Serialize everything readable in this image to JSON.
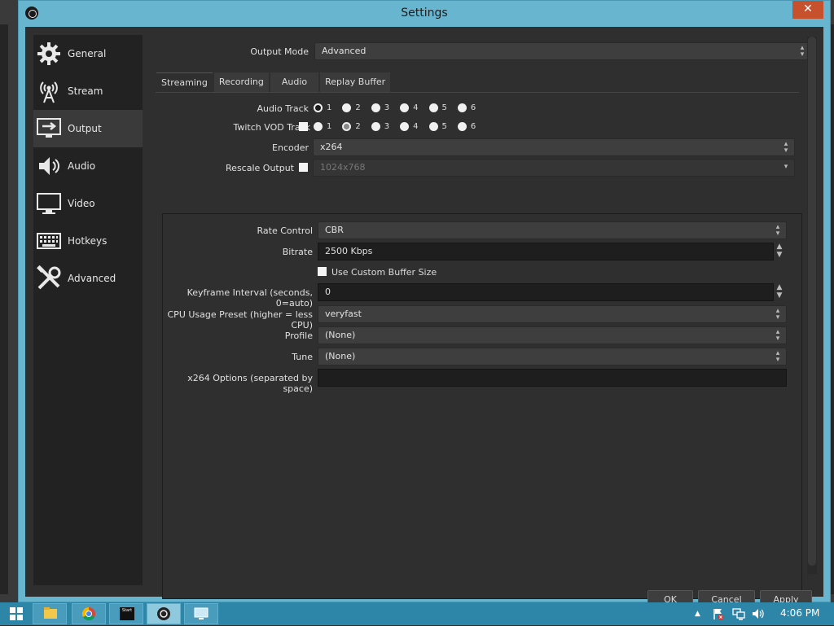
{
  "window": {
    "title": "Settings",
    "close_glyph": "✕"
  },
  "sidebar": {
    "items": [
      {
        "label": "General",
        "icon": "gear-icon"
      },
      {
        "label": "Stream",
        "icon": "broadcast-tower-icon"
      },
      {
        "label": "Output",
        "icon": "output-monitor-icon",
        "active": true
      },
      {
        "label": "Audio",
        "icon": "speaker-icon"
      },
      {
        "label": "Video",
        "icon": "monitor-icon"
      },
      {
        "label": "Hotkeys",
        "icon": "keyboard-icon"
      },
      {
        "label": "Advanced",
        "icon": "tools-icon"
      }
    ]
  },
  "output_mode": {
    "label": "Output Mode",
    "value": "Advanced"
  },
  "tabs": [
    "Streaming",
    "Recording",
    "Audio",
    "Replay Buffer"
  ],
  "streaming": {
    "audio_track": {
      "label": "Audio Track",
      "options": [
        "1",
        "2",
        "3",
        "4",
        "5",
        "6"
      ],
      "selected": "1"
    },
    "twitch_vod_track": {
      "label": "Twitch VOD Track",
      "options": [
        "1",
        "2",
        "3",
        "4",
        "5",
        "6"
      ],
      "selected": "2"
    },
    "encoder": {
      "label": "Encoder",
      "value": "x264"
    },
    "rescale_output": {
      "label": "Rescale Output",
      "value": "1024x768"
    },
    "rate_control": {
      "label": "Rate Control",
      "value": "CBR"
    },
    "bitrate": {
      "label": "Bitrate",
      "value": "2500 Kbps"
    },
    "custom_buffer": {
      "label": "Use Custom Buffer Size"
    },
    "keyframe": {
      "label": "Keyframe Interval (seconds, 0=auto)",
      "value": "0"
    },
    "cpu_preset": {
      "label": "CPU Usage Preset (higher = less CPU)",
      "value": "veryfast"
    },
    "profile": {
      "label": "Profile",
      "value": "(None)"
    },
    "tune": {
      "label": "Tune",
      "value": "(None)"
    },
    "x264_options": {
      "label": "x264 Options (separated by space)",
      "value": ""
    }
  },
  "buttons": {
    "ok": "OK",
    "cancel": "Cancel",
    "apply": "Apply"
  },
  "taskbar": {
    "clock": "4:06 PM",
    "tb_label": "Start",
    "tray_up": "▲"
  },
  "colors": {
    "accent": "#68b5cf",
    "taskbar": "#2d86a8",
    "close": "#c7502d"
  }
}
